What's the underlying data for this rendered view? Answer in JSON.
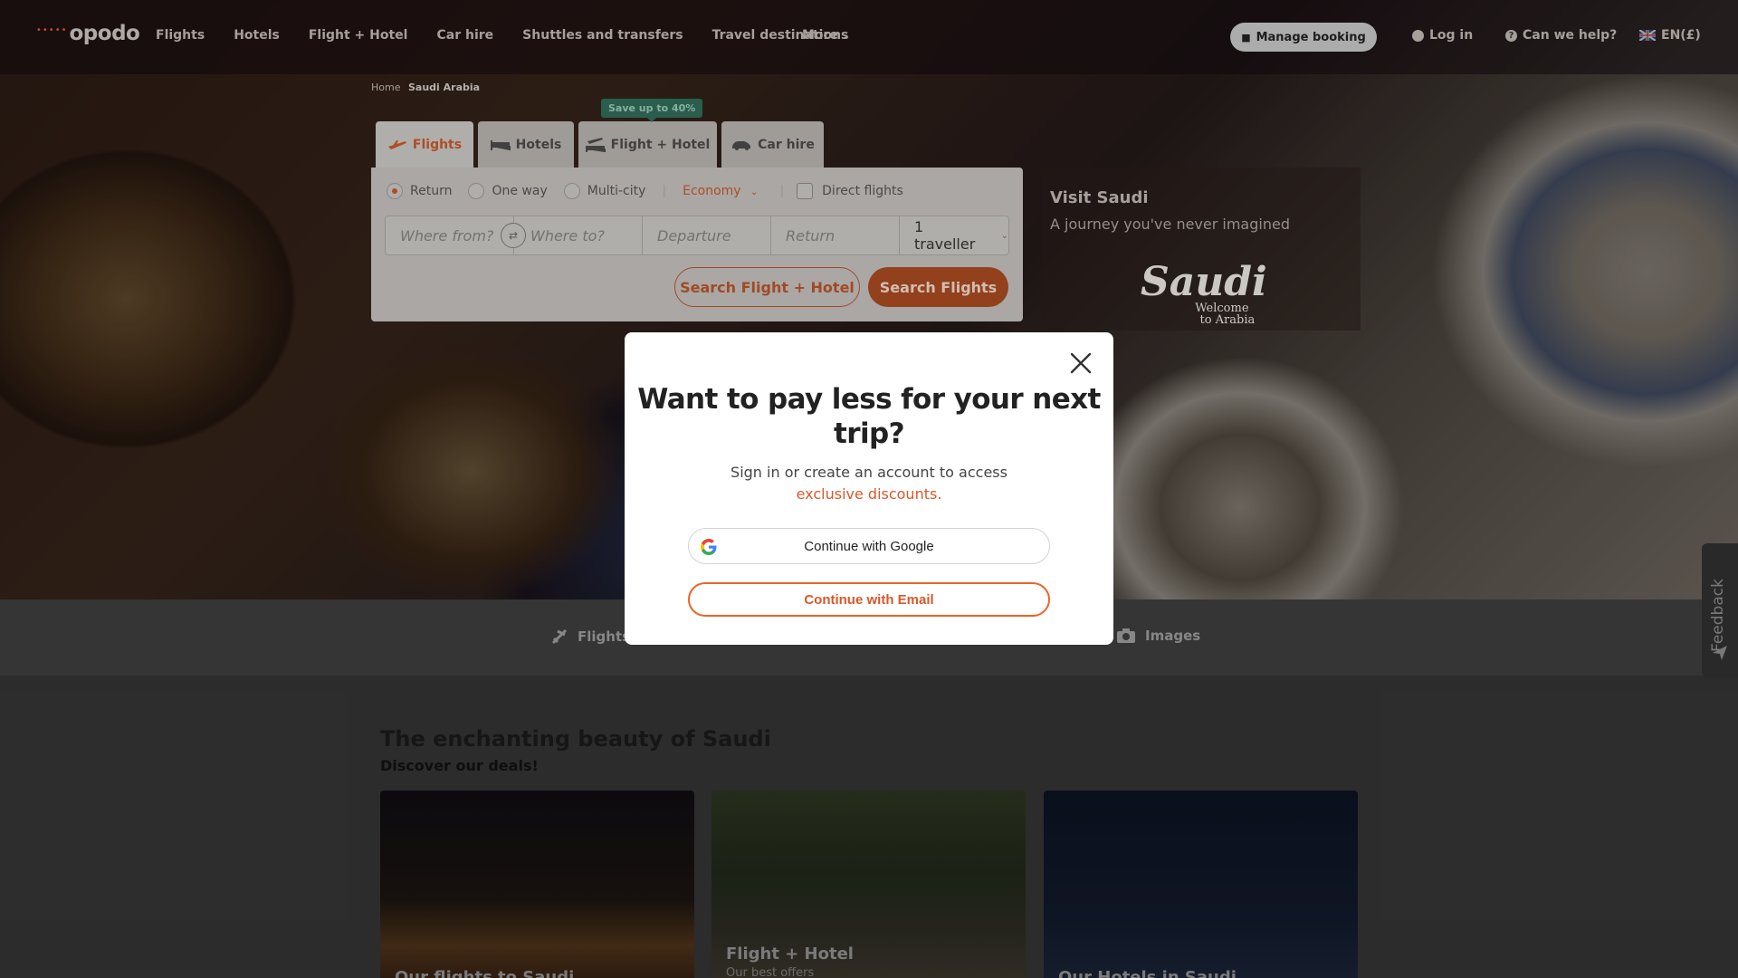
{
  "brand": {
    "logo_text": "opodo",
    "logo_dots": "•••••"
  },
  "topnav": {
    "links": [
      "Flights",
      "Hotels",
      "Flight + Hotel",
      "Car hire",
      "Shuttles and transfers",
      "Travel destinations"
    ],
    "more": "More",
    "manage_booking": "Manage booking",
    "login": "Log in",
    "help": "Can we help?",
    "language": "EN(£)"
  },
  "breadcrumb": {
    "home": "Home",
    "current": "Saudi Arabia"
  },
  "search": {
    "tabs": [
      "Flights",
      "Hotels",
      "Flight + Hotel",
      "Car hire"
    ],
    "active_tab": "Flights",
    "save_badge": "Save up to 40%",
    "trip_types": [
      "Return",
      "One way",
      "Multi-city"
    ],
    "selected_trip": "Return",
    "cabin_class": "Economy",
    "direct_flights": "Direct flights",
    "placeholders": {
      "from": "Where from?",
      "to": "Where to?",
      "departure": "Departure",
      "return": "Return"
    },
    "travellers": "1 traveller",
    "btn_secondary": "Search Flight + Hotel",
    "btn_primary": "Search Flights"
  },
  "promo": {
    "title": "Visit Saudi",
    "subtitle": "A journey you've never imagined",
    "logo_big": "Saudi",
    "logo_small_1": "Welcome",
    "logo_small_2": "to Arabia"
  },
  "subnav": {
    "flights": "Flights",
    "images": "Images"
  },
  "content": {
    "title": "The enchanting beauty of Saudi",
    "subtitle": "Discover our deals!",
    "cards": [
      {
        "title": "Our flights to Saudi",
        "subtitle": ""
      },
      {
        "title": "Flight + Hotel",
        "subtitle": "Our best offers"
      },
      {
        "title": "Our Hotels in Saudi",
        "subtitle": ""
      }
    ]
  },
  "modal": {
    "title": "Want to pay less for your next trip?",
    "body_prefix": "Sign in or create an account to access ",
    "body_accent": "exclusive discounts.",
    "google_btn": "Continue with Google",
    "email_btn": "Continue with Email"
  },
  "feedback": "Feedback",
  "colors": {
    "accent": "#e8652a",
    "accent_text": "#d9582a",
    "save_badge": "#2f6c57"
  }
}
